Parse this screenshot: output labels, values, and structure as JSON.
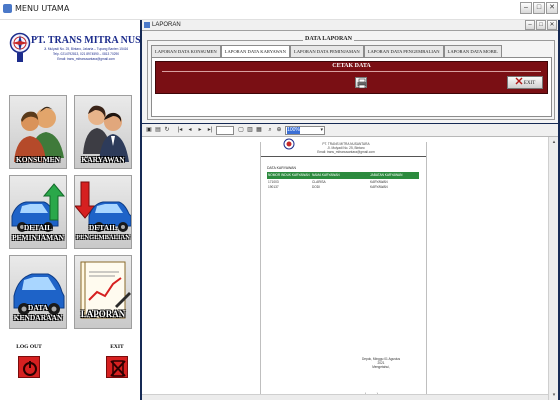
{
  "main_window": {
    "title": "MENU UTAMA",
    "controls": {
      "minimize": "–",
      "maximize": "□",
      "close": "✕"
    }
  },
  "company": {
    "name": "PT. TRANS MITRA NUSANTARA",
    "address_lines": [
      "Jl. Mulyadi No. 25, Bintaro, Jakarta – Tupang Banten 15416",
      "Telp. 0214792813, 021 8974590 – 0813 70290",
      "Email: trans_mitranusantara@gmail.com"
    ],
    "logo_icon": "company-logo-icon"
  },
  "menu_tiles": [
    {
      "label": "KONSUMEN",
      "icon": "customers-icon"
    },
    {
      "label": "KARYAWAN",
      "icon": "employee-icon"
    },
    {
      "label_lines": [
        "DETAIL",
        "PEMINJAMAN"
      ],
      "icon": "car-loan-icon"
    },
    {
      "label_lines": [
        "DETAIL",
        "PENGEMBALIAN"
      ],
      "icon": "car-return-icon"
    },
    {
      "label_lines": [
        "DATA",
        "KENDARAAN"
      ],
      "icon": "vehicle-icon"
    },
    {
      "label": "LAPORAN",
      "icon": "report-icon"
    }
  ],
  "side_actions": {
    "logout_label": "LOG OUT",
    "exit_label": "EXIT"
  },
  "child_window": {
    "title": "LAPORAN",
    "controls": {
      "minimize": "–",
      "maximize": "□",
      "close": "✕"
    }
  },
  "data_panel": {
    "legend": "DATA LAPORAN",
    "tabs": [
      {
        "label": "LAPORAN DATA KONSUMEN",
        "active": false
      },
      {
        "label": "LAPORAN DATA KARYAWAN",
        "active": true
      },
      {
        "label": "LAPORAN DATA PEMINJAMAN",
        "active": false
      },
      {
        "label": "LAPORAN DATA PENGEMBALIAN",
        "active": false
      },
      {
        "label": "LAPORAN DATA MOBIL",
        "active": false
      }
    ],
    "cetak_title": "CETAK DATA",
    "exit_button_label": "EXIT"
  },
  "viewer": {
    "zoom_value": "100%",
    "toolbar_icons": [
      "export-icon",
      "print-icon",
      "refresh-icon",
      "first-page-icon",
      "prev-page-icon",
      "next-page-icon",
      "last-page-icon",
      "goto-page-icon",
      "tree-toggle-icon",
      "search-icon",
      "zoom-icon"
    ]
  },
  "report": {
    "header_lines": [
      "PT. TRANS MITRA NUSANTARA",
      "Jl. Mulyadi No. 25, Bintaro",
      "Email: trans_mitranusantara@gmail.com"
    ],
    "title": "DATA KARYAWAN",
    "columns": [
      "NOMOR INDUK KARYAWAN",
      "NAMA KARYAWAN",
      "JABATAN KARYAWAN"
    ],
    "rows": [
      [
        "171003",
        "CLARISA",
        "KARYAWAN"
      ],
      [
        "190137",
        "DODI",
        "KARYAWAN"
      ]
    ],
    "signature_lines": [
      "Depok, Minggu 01 Agustus 2021",
      "Mengetahui,"
    ],
    "footer": "(............)"
  },
  "colors": {
    "navy": "#162a55",
    "maroon": "#7a0f14",
    "report_green": "#2c8a3e",
    "company_blue": "#1c2c8c"
  }
}
